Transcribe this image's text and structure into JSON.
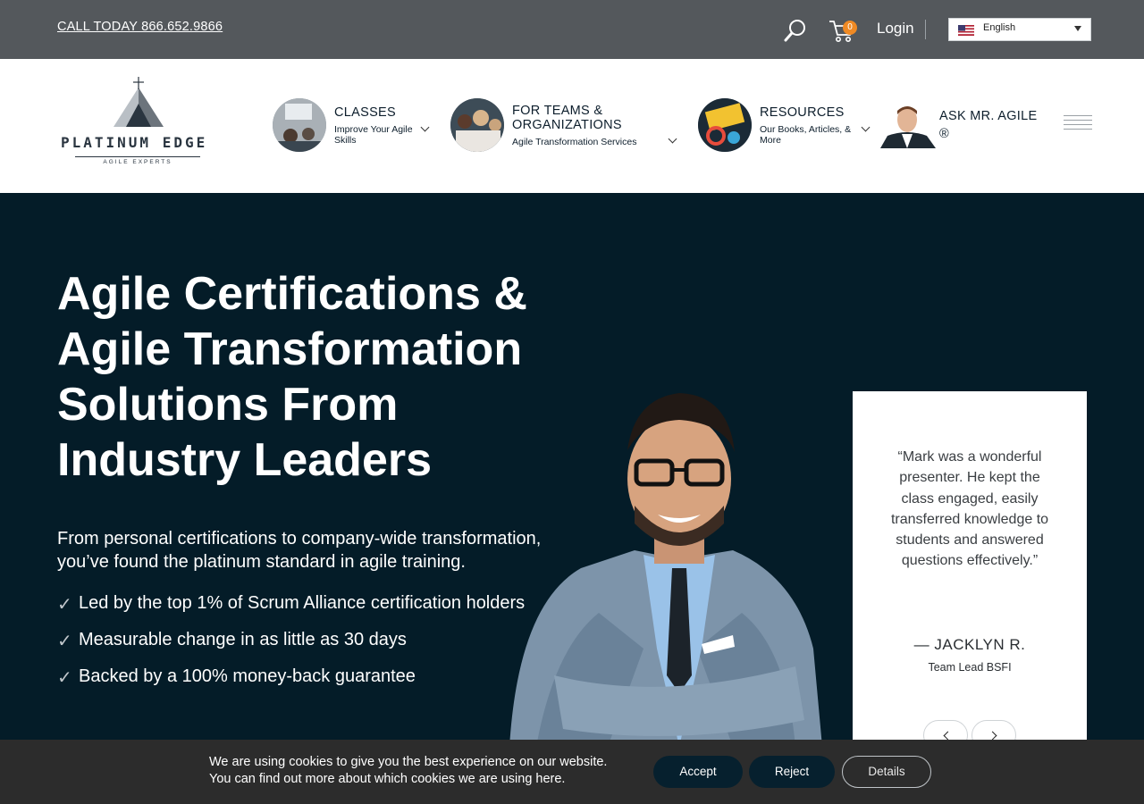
{
  "topbar": {
    "phone_link": "CALL TODAY 866.652.9866",
    "cart_count": "0",
    "login_label": "Login",
    "language": "English"
  },
  "logo": {
    "name": "PLATINUM EDGE",
    "tagline": "AGILE EXPERTS"
  },
  "nav": {
    "items": [
      {
        "title": "CLASSES",
        "subtitle": "Improve Your Agile Skills"
      },
      {
        "title": "FOR TEAMS & ORGANIZATIONS",
        "subtitle": "Agile Transformation Services"
      },
      {
        "title": "RESOURCES",
        "subtitle": "Our Books, Articles, & More"
      },
      {
        "title": "ASK MR. AGILE ®",
        "subtitle": ""
      }
    ]
  },
  "hero": {
    "title": "Agile Certifications & Agile Transformation Solutions From Industry Leaders",
    "subtitle": "From personal certifications to company-wide transformation, you’ve found the platinum standard in agile training.",
    "bullets": [
      "Led by the top 1% of Scrum Alliance certification holders",
      "Measurable change in as little as 30 days",
      "Backed by a 100% money-back guarantee"
    ]
  },
  "testimonial": {
    "quote": "“Mark was a wonderful presenter. He kept the class engaged, easily transferred knowledge to students and answered questions effectively.”",
    "author": "— JACKLYN R.",
    "role": "Team Lead BSFI"
  },
  "cookie": {
    "line1": "We are using cookies to give you the best experience on our website.",
    "line2": "You can find out more about which cookies we are using here.",
    "accept": "Accept",
    "reject": "Reject",
    "details": "Details"
  },
  "colors": {
    "topbar": "#54585c",
    "hero_bg": "#041c28",
    "cart_badge": "#f08a24",
    "cookie_bg": "#2c2c2c"
  }
}
